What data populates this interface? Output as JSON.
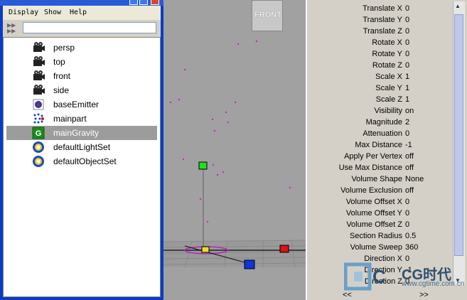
{
  "outliner": {
    "menu": [
      "Display",
      "Show",
      "Help"
    ],
    "filter_value": "",
    "items": [
      {
        "label": "persp",
        "icon": "camera-icon",
        "selected": false
      },
      {
        "label": "top",
        "icon": "camera-icon",
        "selected": false
      },
      {
        "label": "front",
        "icon": "camera-icon",
        "selected": false
      },
      {
        "label": "side",
        "icon": "camera-icon",
        "selected": false
      },
      {
        "label": "baseEmitter",
        "icon": "emitter-icon",
        "selected": false
      },
      {
        "label": "mainpart",
        "icon": "particle-icon",
        "selected": false
      },
      {
        "label": "mainGravity",
        "icon": "gravity-field-icon",
        "selected": true
      },
      {
        "label": "defaultLightSet",
        "icon": "set-icon",
        "selected": false
      },
      {
        "label": "defaultObjectSet",
        "icon": "set-icon",
        "selected": false
      }
    ]
  },
  "viewport": {
    "view_label": "FRONT"
  },
  "channel_box": {
    "attributes": [
      {
        "name": "Translate X",
        "value": "0"
      },
      {
        "name": "Translate Y",
        "value": "0"
      },
      {
        "name": "Translate Z",
        "value": "0"
      },
      {
        "name": "Rotate X",
        "value": "0"
      },
      {
        "name": "Rotate Y",
        "value": "0"
      },
      {
        "name": "Rotate Z",
        "value": "0"
      },
      {
        "name": "Scale X",
        "value": "1"
      },
      {
        "name": "Scale Y",
        "value": "1"
      },
      {
        "name": "Scale Z",
        "value": "1"
      },
      {
        "name": "Visibility",
        "value": "on"
      },
      {
        "name": "Magnitude",
        "value": "2"
      },
      {
        "name": "Attenuation",
        "value": "0"
      },
      {
        "name": "Max Distance",
        "value": "-1"
      },
      {
        "name": "Apply Per Vertex",
        "value": "off"
      },
      {
        "name": "Use Max Distance",
        "value": "off"
      },
      {
        "name": "Volume Shape",
        "value": "None"
      },
      {
        "name": "Volume Exclusion",
        "value": "off"
      },
      {
        "name": "Volume Offset X",
        "value": "0"
      },
      {
        "name": "Volume Offset Y",
        "value": "0"
      },
      {
        "name": "Volume Offset Z",
        "value": "0"
      },
      {
        "name": "Section Radius",
        "value": "0.5"
      },
      {
        "name": "Volume Sweep",
        "value": "360"
      },
      {
        "name": "Direction X",
        "value": "0"
      },
      {
        "name": "Direction Y",
        "value": "-1"
      },
      {
        "name": "Direction Z",
        "value": "0"
      }
    ],
    "nav_left": "<<",
    "nav_right": ">>"
  },
  "watermark": {
    "brand": "CG时代",
    "url": "www.cgtime.com.cn"
  }
}
